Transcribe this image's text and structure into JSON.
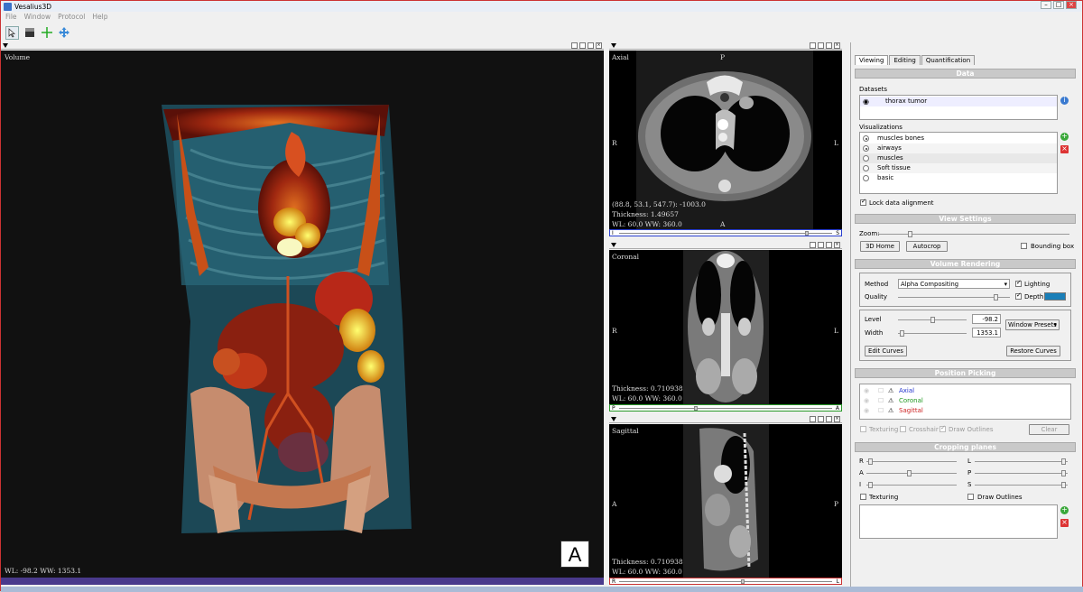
{
  "app": {
    "title": "Vesalius3D"
  },
  "menu": [
    "File",
    "Window",
    "Protocol",
    "Help"
  ],
  "views": {
    "volume": {
      "label": "Volume",
      "wl": "WL: -98.2 WW: 1353.1",
      "marker": "A"
    },
    "axial": {
      "label": "Axial",
      "top": "P",
      "left": "R",
      "right": "L",
      "bottom": "A",
      "info1": "(88.8, 53.1, 547.7): -1003.0",
      "info2": "Thickness: 1.49657",
      "info3": "WL: 60.0 WW: 360.0",
      "bar_left": "I",
      "bar_right": "S",
      "slice_pos": 0.88
    },
    "coronal": {
      "label": "Coronal",
      "left": "R",
      "right": "L",
      "info2": "Thickness: 0.710938",
      "info3": "WL: 60.0 WW: 360.0",
      "bar_left": "P",
      "bar_right": "A",
      "slice_pos": 0.36
    },
    "sagittal": {
      "label": "Sagittal",
      "left": "A",
      "right": "P",
      "info2": "Thickness: 0.710938",
      "info3": "WL: 60.0 WW: 360.0",
      "bar_left": "R",
      "bar_right": "L",
      "slice_pos": 0.58
    }
  },
  "panel": {
    "tabs": [
      "Viewing",
      "Editing",
      "Quantification"
    ],
    "data_title": "Data",
    "datasets_label": "Datasets",
    "dataset": "thorax tumor",
    "visualizations_label": "Visualizations",
    "visualizations": [
      {
        "name": "muscles bones",
        "on": true
      },
      {
        "name": "airways",
        "on": true
      },
      {
        "name": "muscles",
        "on": false
      },
      {
        "name": "Soft tissue",
        "on": false
      },
      {
        "name": "basic",
        "on": false
      }
    ],
    "lock_label": "Lock data alignment",
    "view_settings_title": "View Settings",
    "zoom_label": "Zoom:",
    "home_btn": "3D Home",
    "autocrop_btn": "Autocrop",
    "bbox_label": "Bounding box",
    "vr_title": "Volume Rendering",
    "method_label": "Method",
    "method_value": "Alpha Compositing",
    "lighting_label": "Lighting",
    "quality_label": "Quality",
    "depth_label": "Depth",
    "depth_color": "#1a7fb8",
    "level_label": "Level",
    "level_value": "-98.2",
    "width_label": "Width",
    "width_value": "1353.1",
    "presets_btn": "Window Presets",
    "edit_curves_btn": "Edit Curves",
    "restore_curves_btn": "Restore Curves",
    "picking_title": "Position Picking",
    "picking": [
      {
        "name": "Axial",
        "color": "#2233cc"
      },
      {
        "name": "Coronal",
        "color": "#229922"
      },
      {
        "name": "Sagittal",
        "color": "#cc2222"
      }
    ],
    "texturing_label": "Texturing",
    "crosshair_label": "Crosshair",
    "draw_outlines_label": "Draw Outlines",
    "clear_btn": "Clear",
    "cropping_title": "Cropping planes",
    "crop_rows": [
      {
        "l": "R",
        "r": "L"
      },
      {
        "l": "A",
        "r": "P"
      },
      {
        "l": "I",
        "r": "S"
      }
    ],
    "crop_texturing": "Texturing",
    "crop_draw_outlines": "Draw Outlines"
  }
}
